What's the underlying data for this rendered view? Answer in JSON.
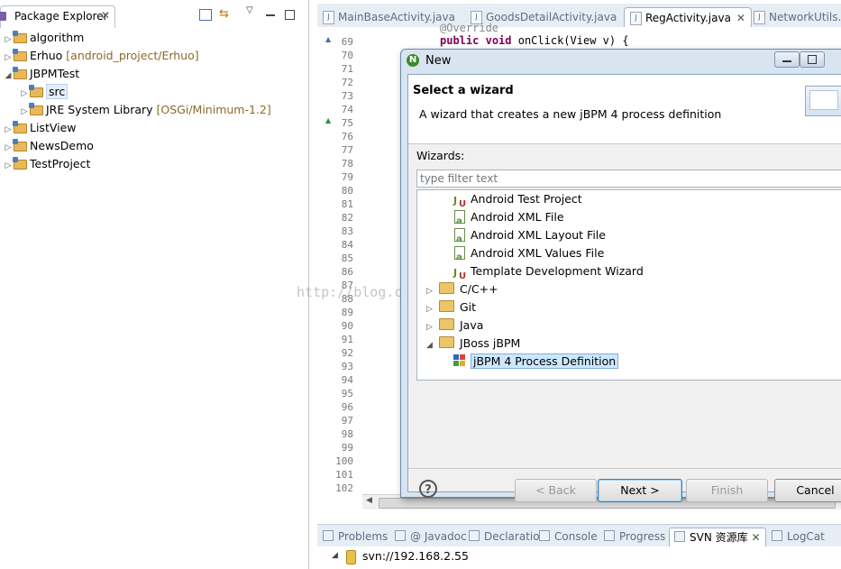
{
  "left_panel": {
    "tab_title": "Package Explorer",
    "tree": [
      {
        "label": "algorithm",
        "suffix": "",
        "indent": 0,
        "expanded": false
      },
      {
        "label": "Erhuo",
        "suffix": " [android_project/Erhuo]",
        "indent": 0,
        "expanded": false
      },
      {
        "label": "JBPMTest",
        "suffix": "",
        "indent": 0,
        "expanded": true
      },
      {
        "label": "src",
        "suffix": "",
        "indent": 1,
        "expanded": false
      },
      {
        "label": "JRE System Library",
        "suffix": " [OSGi/Minimum-1.2]",
        "indent": 1,
        "expanded": false
      },
      {
        "label": "ListView",
        "suffix": "",
        "indent": 0,
        "expanded": false
      },
      {
        "label": "NewsDemo",
        "suffix": "",
        "indent": 0,
        "expanded": false
      },
      {
        "label": "TestProject",
        "suffix": "",
        "indent": 0,
        "expanded": false
      }
    ]
  },
  "editor": {
    "tabs": [
      "MainBaseActivity.java",
      "GoodsDetailActivity.java",
      "RegActivity.java",
      "NetworkUtils.java"
    ],
    "active_tab": "RegActivity.java",
    "line_numbers": [
      "69",
      "70",
      "71",
      "72",
      "73",
      "74",
      "75",
      "76",
      "77",
      "78",
      "79",
      "80",
      "81",
      "82",
      "83",
      "84",
      "85",
      "86",
      "87",
      "88",
      "89",
      "90",
      "91",
      "92",
      "93",
      "94",
      "95",
      "96",
      "97",
      "98",
      "99",
      "100",
      "101",
      "102"
    ],
    "code_keyword1": "public",
    "code_keyword2": "void",
    "code_rest": "onClick(View v) {",
    "code_partial": "@Override"
  },
  "bottom_panel": {
    "tabs": [
      "Problems",
      "@ Javadoc",
      "Declaration",
      "Console",
      "Progress",
      "SVN 资源库",
      "LogCat"
    ],
    "active_tab": "SVN 资源库",
    "repo_item": "svn://192.168.2.55"
  },
  "dialog": {
    "title": "New",
    "heading": "Select a wizard",
    "description": "A wizard that creates a new jBPM 4 process definition",
    "wizards_label": "Wizards:",
    "filter_placeholder": "type filter text",
    "items": [
      {
        "label": "Android Test Project",
        "kind": "leaf",
        "icon": "junit-icon"
      },
      {
        "label": "Android XML File",
        "kind": "leaf",
        "icon": "android-file-icon"
      },
      {
        "label": "Android XML Layout File",
        "kind": "leaf",
        "icon": "android-file-icon"
      },
      {
        "label": "Android XML Values File",
        "kind": "leaf",
        "icon": "android-file-icon"
      },
      {
        "label": "Template Development Wizard",
        "kind": "leaf",
        "icon": "junit-icon"
      },
      {
        "label": "C/C++",
        "kind": "folder",
        "expanded": false
      },
      {
        "label": "Git",
        "kind": "folder",
        "expanded": false
      },
      {
        "label": "Java",
        "kind": "folder",
        "expanded": false
      },
      {
        "label": "JBoss jBPM",
        "kind": "folder",
        "expanded": true
      },
      {
        "label": "jBPM 4 Process Definition",
        "kind": "leaf",
        "icon": "jbpm-icon",
        "selected": true
      }
    ],
    "buttons": {
      "back": "< Back",
      "next": "Next >",
      "finish": "Finish",
      "cancel": "Cancel"
    }
  },
  "watermark": "http://blog.csdn.net/needkane",
  "colors": {
    "selection": "#cce8ff",
    "keyword": "#7f0055",
    "title_bar": "#d9e4f1"
  }
}
